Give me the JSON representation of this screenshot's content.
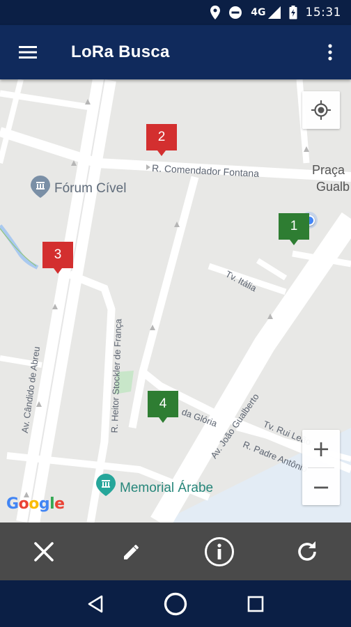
{
  "status_bar": {
    "network": "4G",
    "time": "15:31",
    "icons": [
      "location-icon",
      "do-not-disturb-icon",
      "signal-icon",
      "battery-icon"
    ]
  },
  "app_bar": {
    "title": "LoRa Busca",
    "menu_icon": "hamburger-menu-icon",
    "overflow_icon": "more-vert-icon"
  },
  "map": {
    "street_labels": [
      "R. Comendador Fontana",
      "Tv. Itália",
      "R. Heitor Stockler de França",
      "Av. Cândido de Abreu",
      "da Glória",
      "Av. João Gualberto",
      "Tv. Rui Leão",
      "R. Padre Antônio"
    ],
    "poi_labels": {
      "forum": "Fórum Cível",
      "memorial": "Memorial Árabe",
      "praca_line1": "Praça",
      "praca_line2": "Gualb"
    },
    "markers": [
      {
        "label": "1",
        "color": "#2e7d32"
      },
      {
        "label": "2",
        "color": "#d32f2f"
      },
      {
        "label": "3",
        "color": "#d32f2f"
      },
      {
        "label": "4",
        "color": "#2e7d32"
      }
    ],
    "zoom_in": "+",
    "zoom_out": "−",
    "attribution": "Google",
    "my_location_color": "#4285f4"
  },
  "toolbar": {
    "buttons": [
      {
        "name": "close-icon"
      },
      {
        "name": "edit-pencil-icon"
      },
      {
        "name": "info-icon"
      },
      {
        "name": "refresh-icon"
      }
    ]
  },
  "nav_bar": {
    "buttons": [
      "back-icon",
      "home-icon",
      "recents-icon"
    ]
  },
  "colors": {
    "status_bar": "#0b1f45",
    "app_bar": "#102a5c",
    "toolbar": "#4a4a4a",
    "map_background": "#e8e8e6",
    "road": "#ffffff",
    "poi_teal": "#4db6ac"
  }
}
